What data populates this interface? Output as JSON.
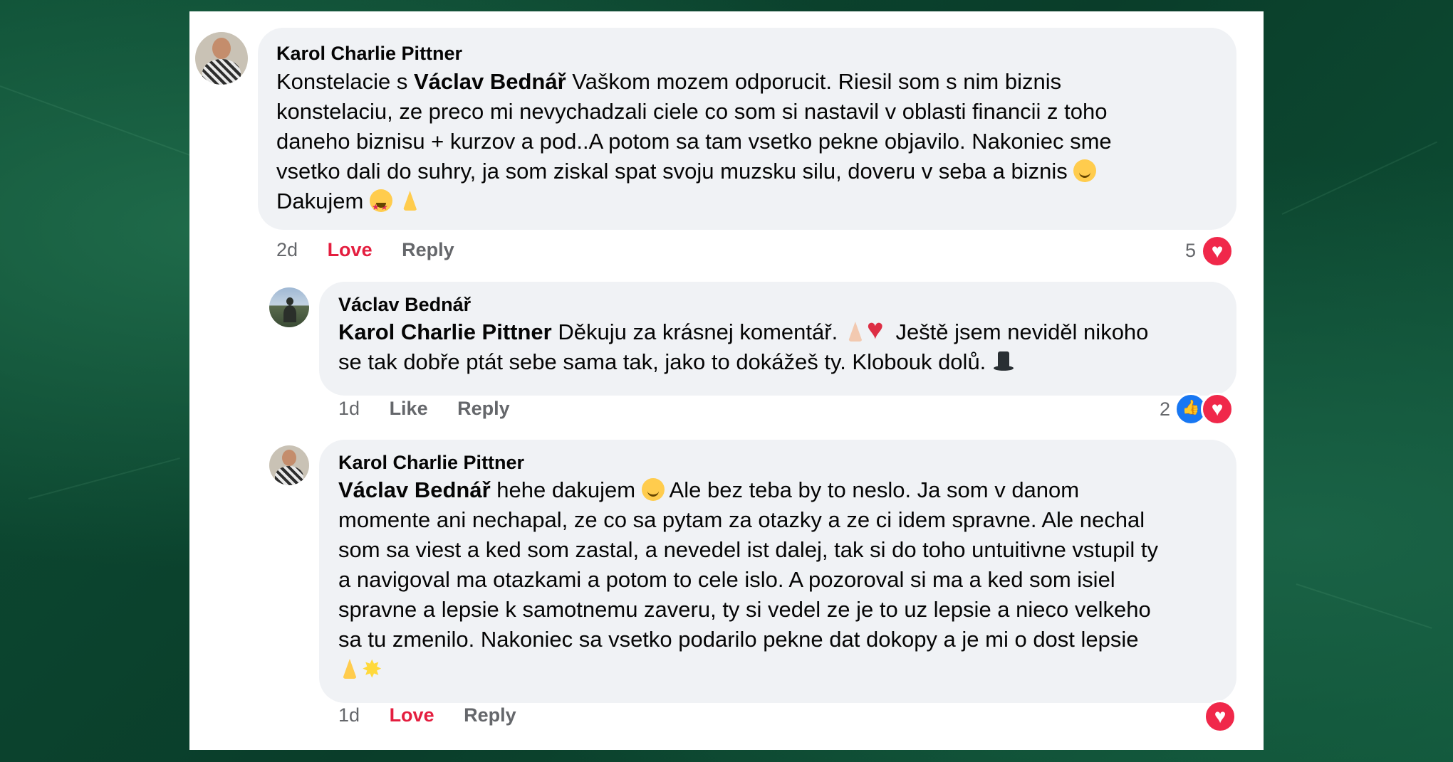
{
  "comments": [
    {
      "author": "Karol Charlie Pittner",
      "text": {
        "l1a": "Konstelacie s ",
        "l1b": "Václav Bednář",
        "l1c": " Vaškom mozem odporucit. Riesil som s nim biznis",
        "l2": "konstelaciu, ze preco mi nevychadzali ciele co som si nastavil v oblasti financii z toho",
        "l3": "daneho biznisu + kurzov a pod..A potom sa tam vsetko pekne objavilo. Nakoniec sme",
        "l4": "vsetko dali do suhry, ja som ziskal spat svoju muzsku silu, doveru v seba a biznis ",
        "l5": "Dakujem "
      },
      "time": "2d",
      "reaction_label": "Love",
      "reply_label": "Reply",
      "reaction_count": "5"
    },
    {
      "author": "Václav Bednář",
      "text": {
        "l1a": "Karol Charlie Pittner",
        "l1b": " Děkuju za krásnej komentář. ",
        "l1c": " Ještě jsem neviděl nikoho",
        "l2": "se tak dobře ptát sebe sama tak, jako to dokážeš ty. Klobouk dolů. "
      },
      "time": "1d",
      "reaction_label": "Like",
      "reply_label": "Reply",
      "reaction_count": "2"
    },
    {
      "author": "Karol Charlie Pittner",
      "text": {
        "l1a": "Václav Bednář",
        "l1b": " hehe dakujem ",
        "l1c": " Ale bez teba by to neslo. Ja som v danom",
        "l2": "momente ani nechapal, ze co sa pytam za otazky a ze ci idem spravne. Ale nechal",
        "l3": "som sa viest a ked som zastal, a nevedel ist dalej, tak si do toho untuitivne vstupil ty",
        "l4": "a navigoval ma otazkami a potom to cele islo. A pozoroval si ma a ked som isiel",
        "l5": "spravne a lepsie k samotnemu zaveru, ty si vedel ze je to uz lepsie a nieco velkeho",
        "l6": "sa tu zmenilo. Nakoniec sa vsetko podarilo pekne dat dokopy a je mi o dost lepsie"
      },
      "time": "1d",
      "reaction_label": "Love",
      "reply_label": "Reply"
    }
  ],
  "colors": {
    "love": "#e41e3f",
    "like": "#1877f2",
    "bubble": "#f0f2f5",
    "meta": "#65676b"
  },
  "icons": [
    "smile-emoji",
    "star-struck-emoji",
    "folded-hands-emoji",
    "red-heart-emoji",
    "top-hat-emoji",
    "sparkle-emoji",
    "love-reaction-icon",
    "like-reaction-icon"
  ]
}
